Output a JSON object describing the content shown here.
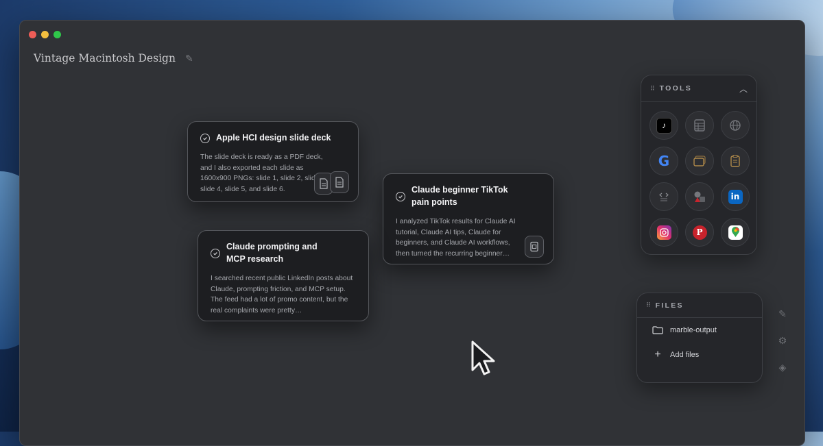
{
  "window": {
    "title": "Vintage Macintosh Design"
  },
  "cards": [
    {
      "title": "Apple HCI design slide deck",
      "body": "The slide deck is ready as a PDF deck, and I also exported each slide as 1600x900 PNGs: slide 1, slide 2, slide 3, slide 4, slide 5, and slide 6."
    },
    {
      "title": "Claude beginner TikTok pain points",
      "body": "I analyzed TikTok results for Claude AI tutorial, Claude AI tips, Claude for beginners, and Claude AI workflows, then turned the recurring beginner…"
    },
    {
      "title": "Claude prompting and MCP research",
      "body": "I searched recent public LinkedIn posts about Claude, prompting friction, and MCP setup. The feed had a lot of promo content, but the real complaints were pretty…"
    }
  ],
  "tools": {
    "title": "TOOLS",
    "items": [
      {
        "icon": "tiktok-icon",
        "color": "#000000"
      },
      {
        "icon": "spreadsheet-icon",
        "color": "#6e7075"
      },
      {
        "icon": "globe-icon",
        "color": "#6e7075"
      },
      {
        "icon": "google-icon",
        "color": "#4285f4"
      },
      {
        "icon": "slides-icon",
        "color": "#b08a4a"
      },
      {
        "icon": "clipboard-icon",
        "color": "#b08a4a"
      },
      {
        "icon": "code-doc-icon",
        "color": "#6e7075"
      },
      {
        "icon": "shapes-icon",
        "color": "#6e7075"
      },
      {
        "icon": "linkedin-icon",
        "color": "#0a66c2"
      },
      {
        "icon": "instagram-icon",
        "color": "#e1306c"
      },
      {
        "icon": "pinterest-icon",
        "color": "#c8232c"
      },
      {
        "icon": "google-maps-icon",
        "color": "#34a853"
      }
    ]
  },
  "files": {
    "title": "FILES",
    "items": [
      {
        "label": "marble-output"
      }
    ],
    "add_label": "Add files"
  }
}
